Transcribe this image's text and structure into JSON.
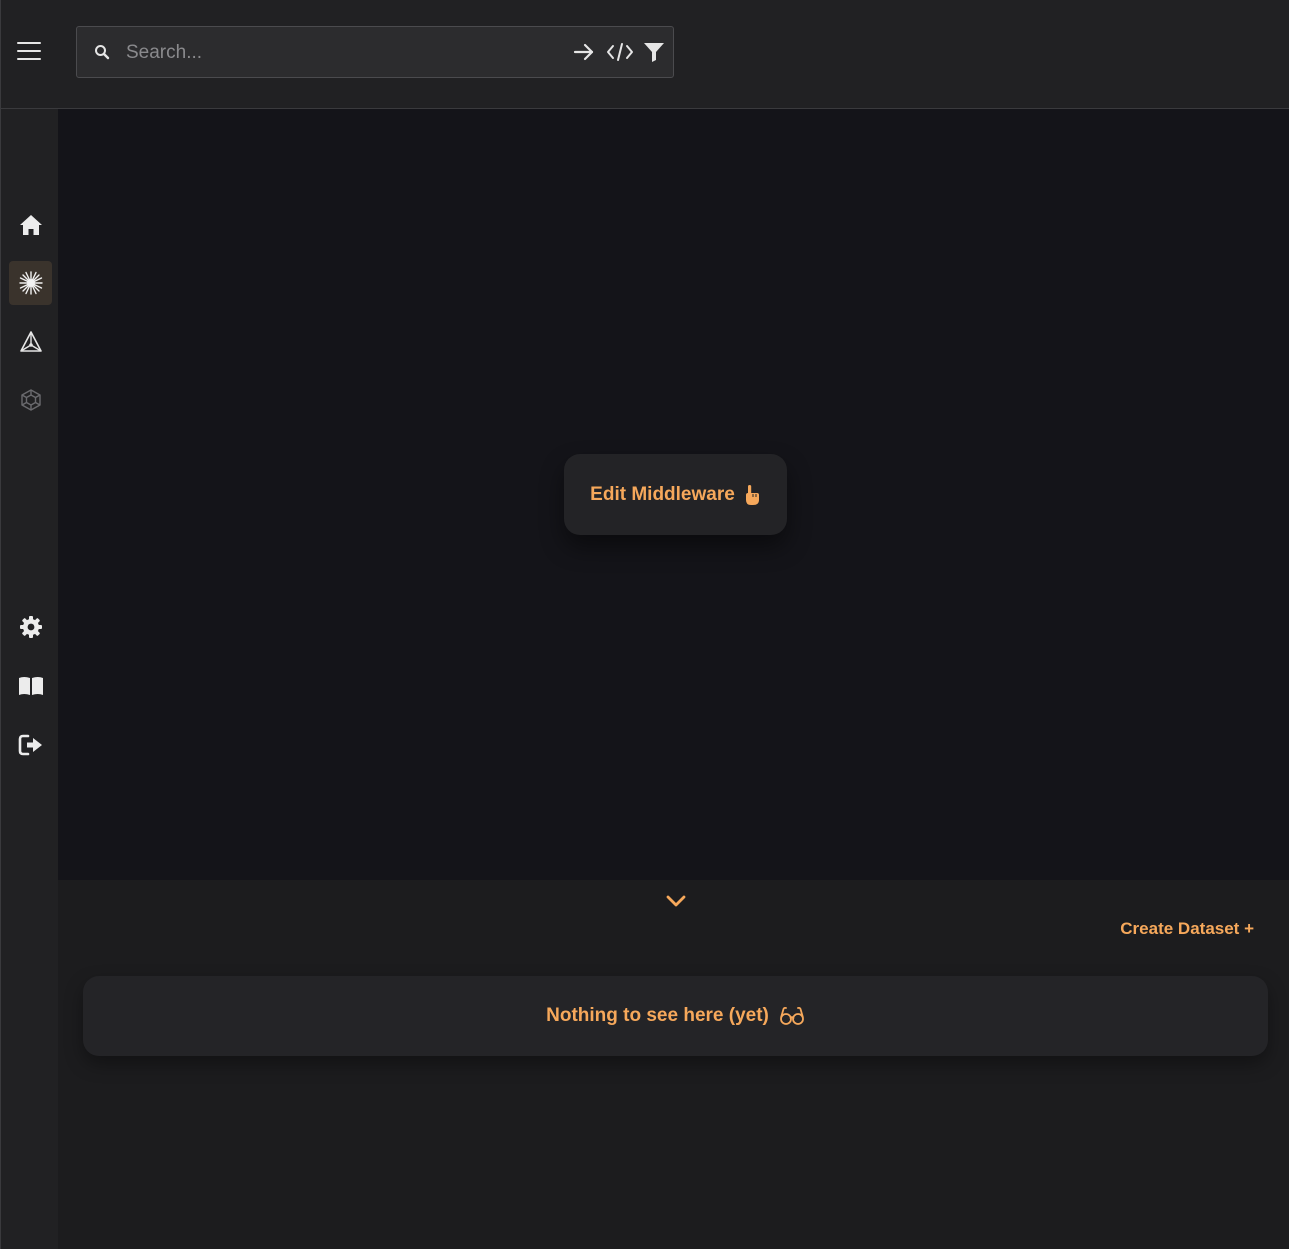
{
  "header": {
    "menu_icon": "hamburger-menu-icon",
    "search": {
      "placeholder": "Search...",
      "value": "",
      "icons": [
        "search-icon",
        "arrow-right-icon",
        "code-icon",
        "filter-icon"
      ]
    }
  },
  "sidebar": {
    "top_items": [
      {
        "icon": "home-icon",
        "active": false
      },
      {
        "icon": "spark-burst-icon",
        "active": true
      },
      {
        "icon": "triangle-graph-icon",
        "active": false
      },
      {
        "icon": "cube-network-icon",
        "active": false
      }
    ],
    "bottom_items": [
      {
        "icon": "gear-icon"
      },
      {
        "icon": "book-icon"
      },
      {
        "icon": "logout-icon"
      }
    ]
  },
  "canvas": {
    "edit_button_label": "Edit Middleware",
    "edit_button_icon": "pointing-hand-icon"
  },
  "panel": {
    "collapse_icon": "chevron-down-icon",
    "create_dataset_label": "Create Dataset +",
    "empty_message": "Nothing to see here (yet)",
    "empty_icon": "glasses-icon"
  },
  "colors": {
    "accent": "#f6a85b",
    "canvas_bg": "#141419",
    "panel_bg": "#1c1c1e",
    "header_bg": "#212123"
  }
}
